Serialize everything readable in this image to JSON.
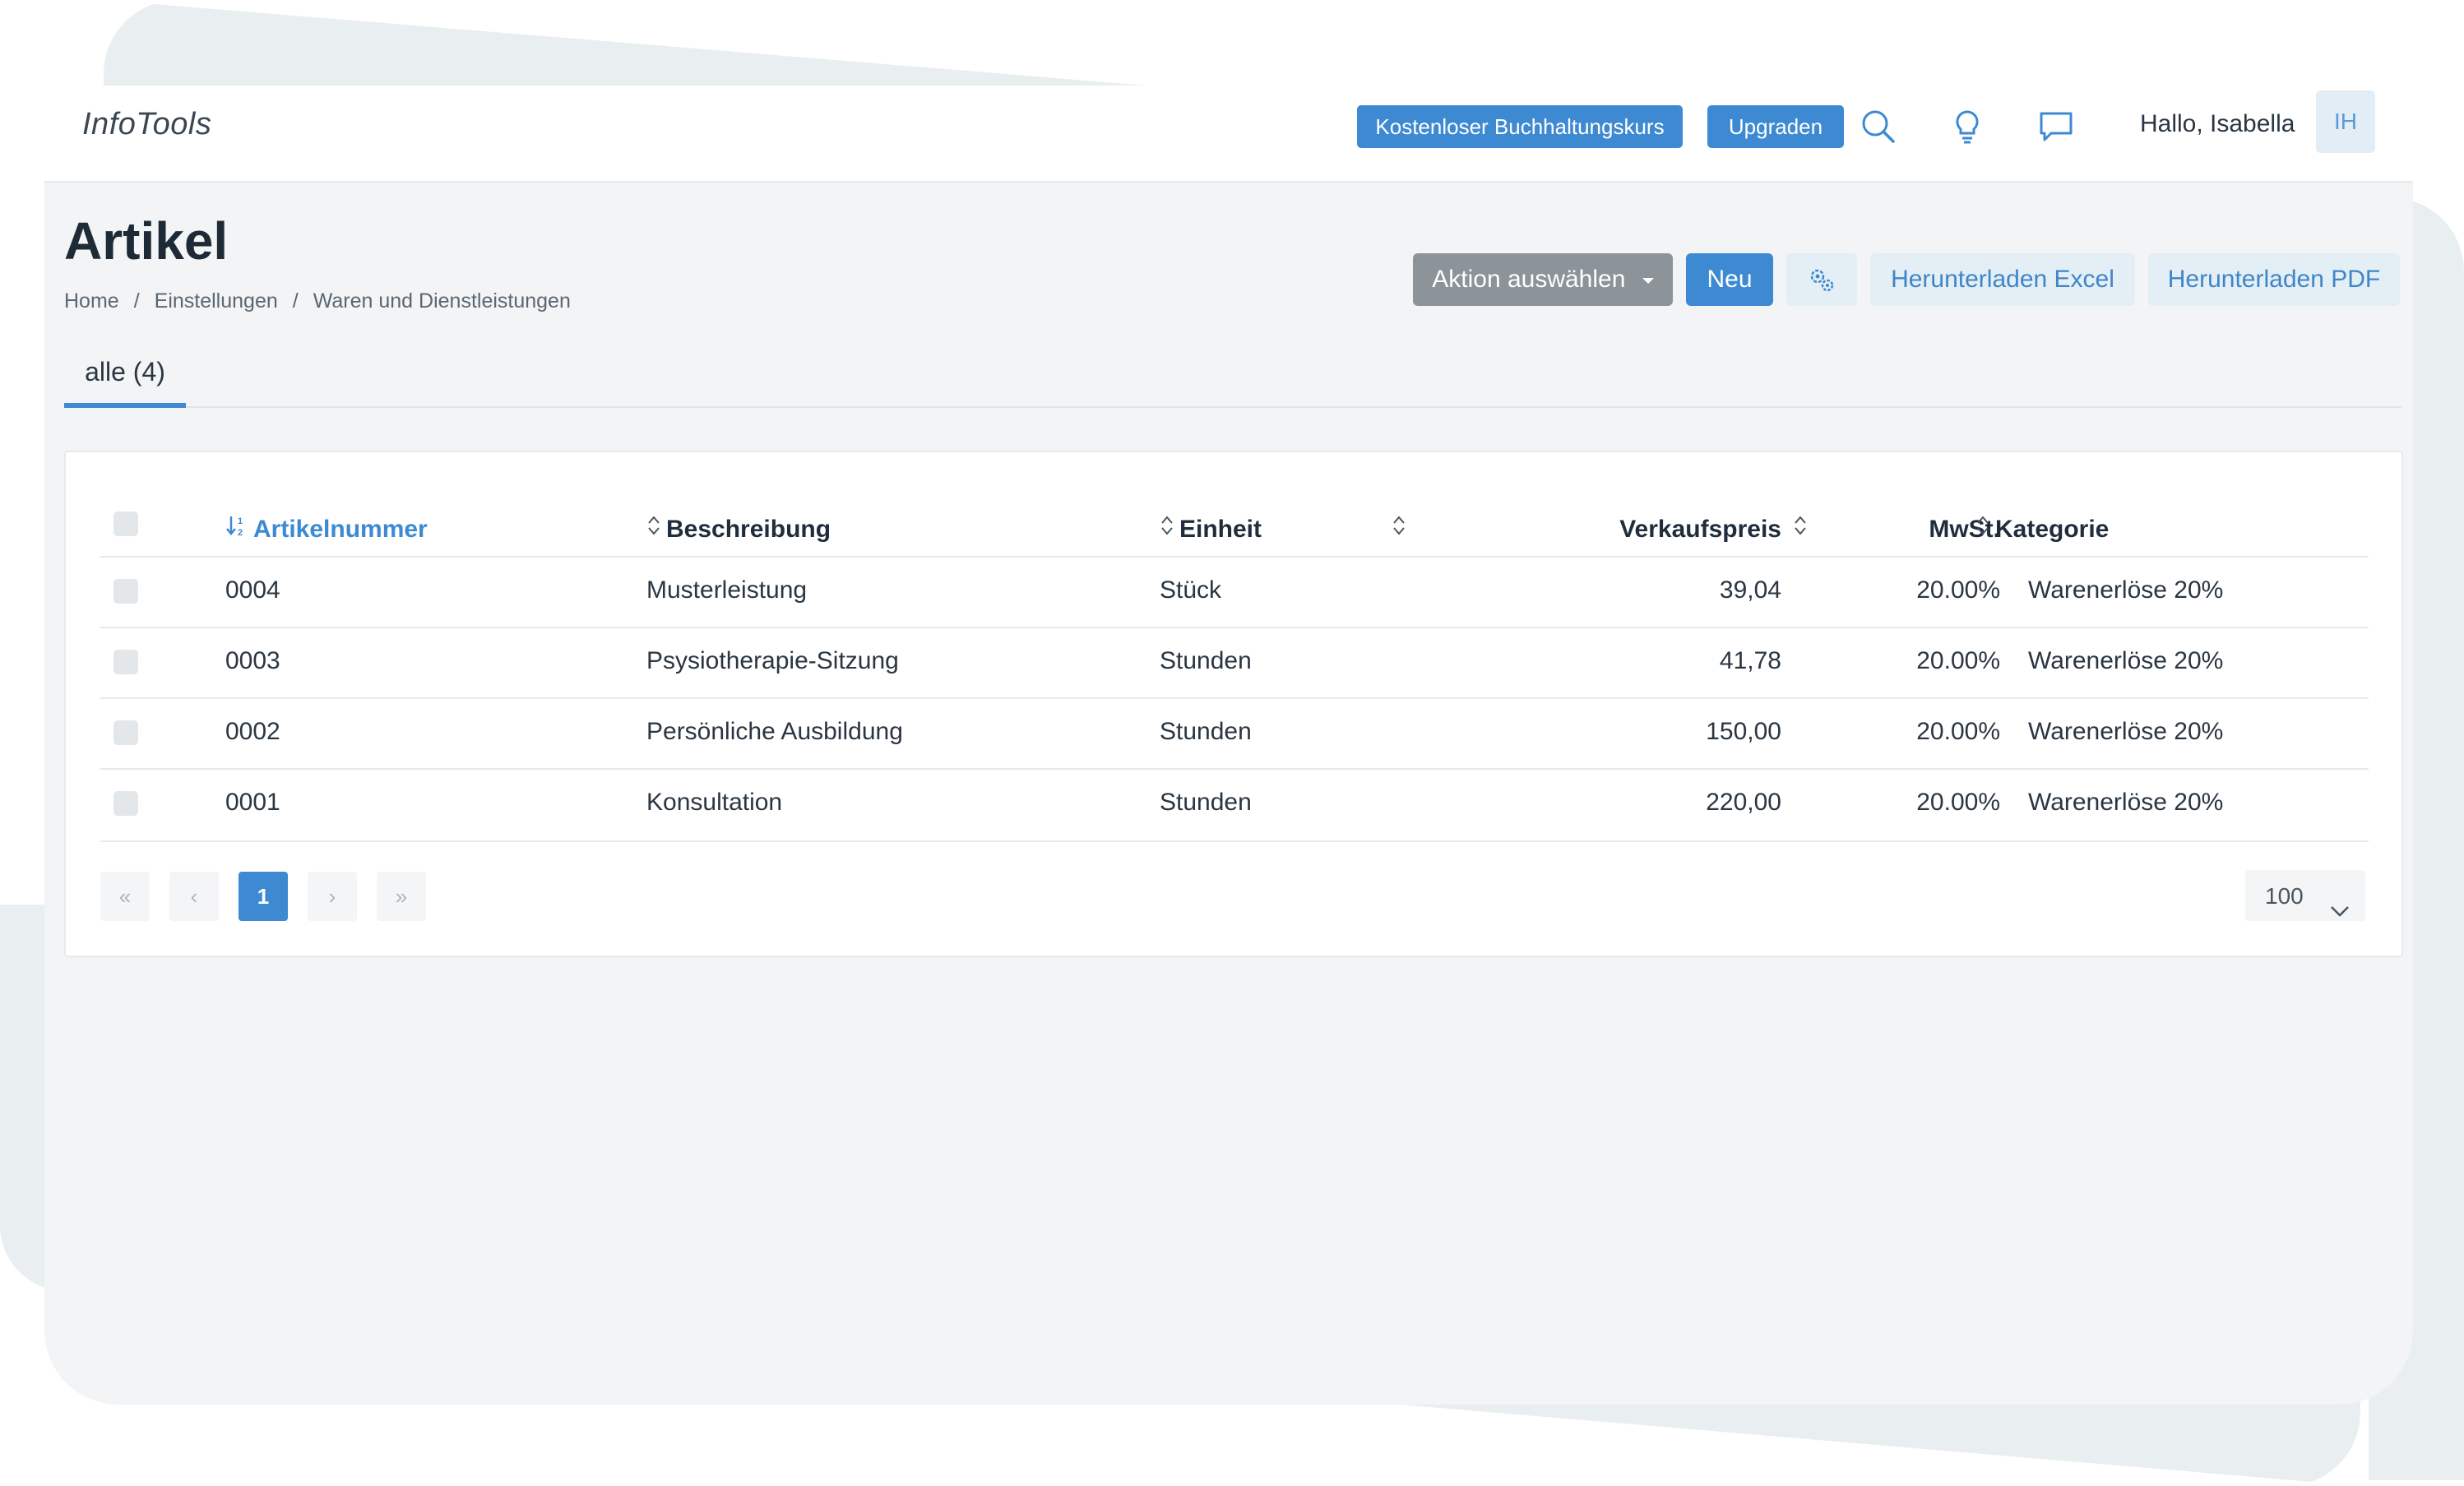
{
  "app": {
    "logo": "InfoTools"
  },
  "topbar": {
    "course_label": "Kostenloser Buchhaltungskurs",
    "upgrade_label": "Upgraden",
    "greeting": "Hallo, Isabella",
    "avatar_initials": "IH"
  },
  "page": {
    "title": "Artikel",
    "breadcrumb": [
      "Home",
      "Einstellungen",
      "Waren und Dienstleistungen"
    ],
    "tab_label": "alle (4)"
  },
  "actions": {
    "select_action": "Aktion auswählen",
    "new": "Neu",
    "download_excel": "Herunterladen Excel",
    "download_pdf": "Herunterladen PDF"
  },
  "table": {
    "columns": {
      "number": "Artikelnummer",
      "description": "Beschreibung",
      "unit": "Einheit",
      "price": "Verkaufspreis",
      "vat": "MwSt.",
      "category": "Kategorie"
    },
    "rows": [
      {
        "number": "0004",
        "description": "Musterleistung",
        "unit": "Stück",
        "price": "39,04",
        "vat": "20.00%",
        "category": "Warenerlöse 20%"
      },
      {
        "number": "0003",
        "description": "Psysiotherapie-Sitzung",
        "unit": "Stunden",
        "price": "41,78",
        "vat": "20.00%",
        "category": "Warenerlöse 20%"
      },
      {
        "number": "0002",
        "description": "Persönliche Ausbildung",
        "unit": "Stunden",
        "price": "150,00",
        "vat": "20.00%",
        "category": "Warenerlöse 20%"
      },
      {
        "number": "0001",
        "description": "Konsultation",
        "unit": "Stunden",
        "price": "220,00",
        "vat": "20.00%",
        "category": "Warenerlöse 20%"
      }
    ]
  },
  "pagination": {
    "first": "«",
    "prev": "‹",
    "current": "1",
    "next": "›",
    "last": "»",
    "page_size": "100"
  },
  "colors": {
    "accent": "#3d8ad2",
    "gray_button": "#8c9399",
    "light_button": "#e4eef5"
  }
}
